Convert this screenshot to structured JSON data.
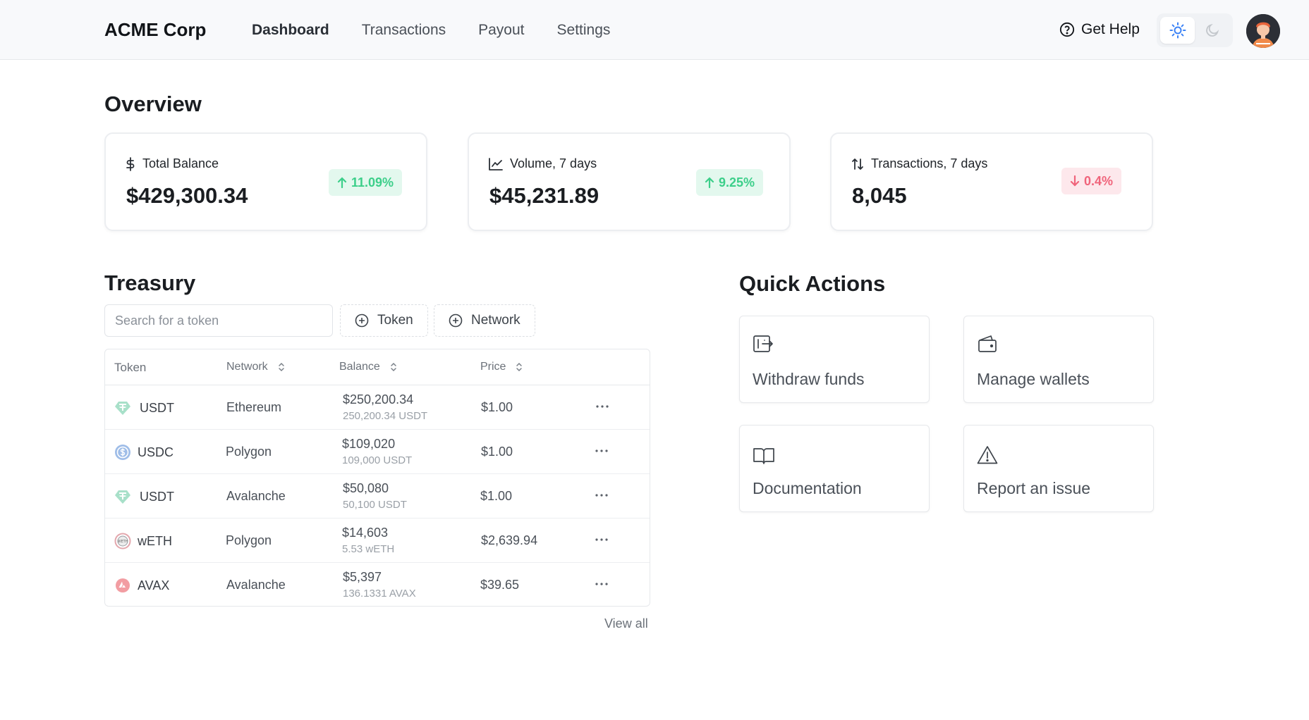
{
  "header": {
    "brand": "ACME Corp",
    "nav": [
      {
        "label": "Dashboard",
        "active": true
      },
      {
        "label": "Transactions",
        "active": false
      },
      {
        "label": "Payout",
        "active": false
      },
      {
        "label": "Settings",
        "active": false
      }
    ],
    "help_label": "Get Help",
    "theme": "light",
    "accent": "#3b82f6"
  },
  "overview": {
    "title": "Overview",
    "cards": [
      {
        "icon": "dollar-icon",
        "label": "Total Balance",
        "value": "$429,300.34",
        "change": "11.09%",
        "trend": "up"
      },
      {
        "icon": "line-chart-icon",
        "label": "Volume, 7 days",
        "value": "$45,231.89",
        "change": "9.25%",
        "trend": "up"
      },
      {
        "icon": "sort-arrows-icon",
        "label": "Transactions, 7 days",
        "value": "8,045",
        "change": "0.4%",
        "trend": "down"
      }
    ]
  },
  "treasury": {
    "title": "Treasury",
    "search_placeholder": "Search for a token",
    "filters": [
      "Token",
      "Network"
    ],
    "columns": [
      "Token",
      "Network",
      "Balance",
      "Price"
    ],
    "rows": [
      {
        "token": "USDT",
        "icon": "tether-icon",
        "network": "Ethereum",
        "balance": "$250,200.34",
        "balance_sub": "250,200.34 USDT",
        "price": "$1.00"
      },
      {
        "token": "USDC",
        "icon": "usdc-icon",
        "network": "Polygon",
        "balance": "$109,020",
        "balance_sub": "109,000 USDT",
        "price": "$1.00"
      },
      {
        "token": "USDT",
        "icon": "tether-icon",
        "network": "Avalanche",
        "balance": "$50,080",
        "balance_sub": "50,100 USDT",
        "price": "$1.00"
      },
      {
        "token": "wETH",
        "icon": "weth-icon",
        "network": "Polygon",
        "balance": "$14,603",
        "balance_sub": "5.53 wETH",
        "price": "$2,639.94"
      },
      {
        "token": "AVAX",
        "icon": "avax-icon",
        "network": "Avalanche",
        "balance": "$5,397",
        "balance_sub": "136.1331 AVAX",
        "price": "$39.65"
      }
    ],
    "view_all": "View all"
  },
  "quick_actions": {
    "title": "Quick Actions",
    "items": [
      {
        "label": "Withdraw funds",
        "icon": "withdraw-icon"
      },
      {
        "label": "Manage wallets",
        "icon": "wallet-icon"
      },
      {
        "label": "Documentation",
        "icon": "book-icon"
      },
      {
        "label": "Report an issue",
        "icon": "warning-icon"
      }
    ]
  }
}
